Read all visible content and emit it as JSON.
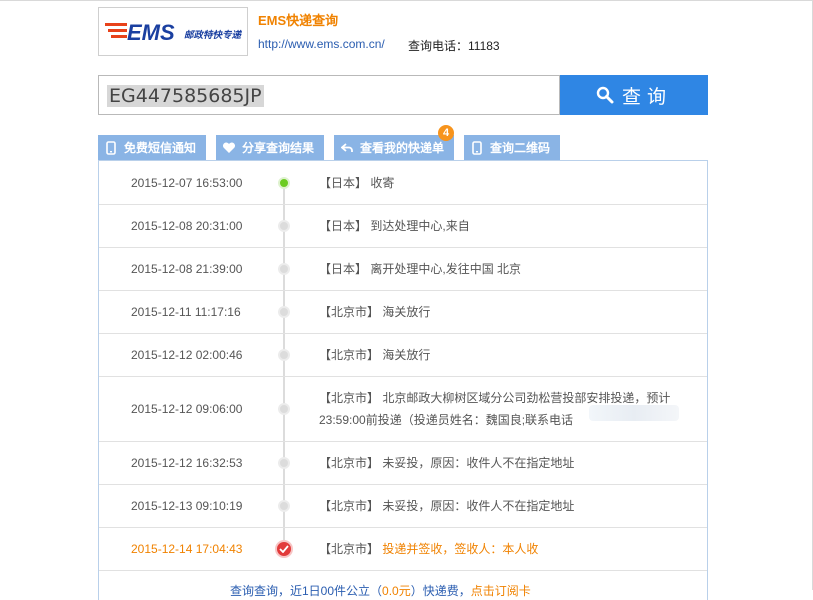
{
  "header": {
    "logo_main": "EMS",
    "logo_sub": "邮政特快专递",
    "title": "EMS快递查询",
    "url": "http://www.ems.com.cn/",
    "phone": "查询电话：11183"
  },
  "search": {
    "value": "EG447585685JP",
    "button_label": "查询"
  },
  "tabs": [
    {
      "label": "免费短信通知",
      "icon": "phone-icon"
    },
    {
      "label": "分享查询结果",
      "icon": "heart-icon"
    },
    {
      "label": "查看我的快递单",
      "icon": "back-arrow-icon"
    },
    {
      "label": "查询二维码",
      "icon": "phone-icon"
    }
  ],
  "badge_count": "4",
  "tracking": [
    {
      "time": "2015-12-07 16:53:00",
      "place": "【日本】",
      "text": "收寄"
    },
    {
      "time": "2015-12-08 20:31:00",
      "place": "【日本】",
      "text": "到达处理中心,来自"
    },
    {
      "time": "2015-12-08 21:39:00",
      "place": "【日本】",
      "text": "离开处理中心,发往中国 北京"
    },
    {
      "time": "2015-12-11 11:17:16",
      "place": "【北京市】",
      "text": "海关放行"
    },
    {
      "time": "2015-12-12 02:00:46",
      "place": "【北京市】",
      "text": "海关放行"
    },
    {
      "time": "2015-12-12 09:06:00",
      "place": "【北京市】",
      "text": "北京邮政大柳树区域分公司劲松营投部安排投递，预计23:59:00前投递（投递员姓名：魏国良;联系电话"
    },
    {
      "time": "2015-12-12 16:32:53",
      "place": "【北京市】",
      "text": "未妥投，原因：收件人不在指定地址"
    },
    {
      "time": "2015-12-13 09:10:19",
      "place": "【北京市】",
      "text": "未妥投，原因：收件人不在指定地址"
    },
    {
      "time": "2015-12-14 17:04:43",
      "place": "【北京市】",
      "text": "投递并签收，签收人：本人收"
    }
  ],
  "footer": {
    "part1": "查询查询，近1日00件公立（",
    "part2": "0.0元",
    "part3": "）快递费，",
    "part4": "点击订阅卡"
  },
  "colors": {
    "accent_orange": "#f08200",
    "button_blue": "#2f86e4",
    "tab_blue": "#8ab4e5",
    "status_green": "#6dcc22",
    "status_red": "#e23a3a"
  }
}
